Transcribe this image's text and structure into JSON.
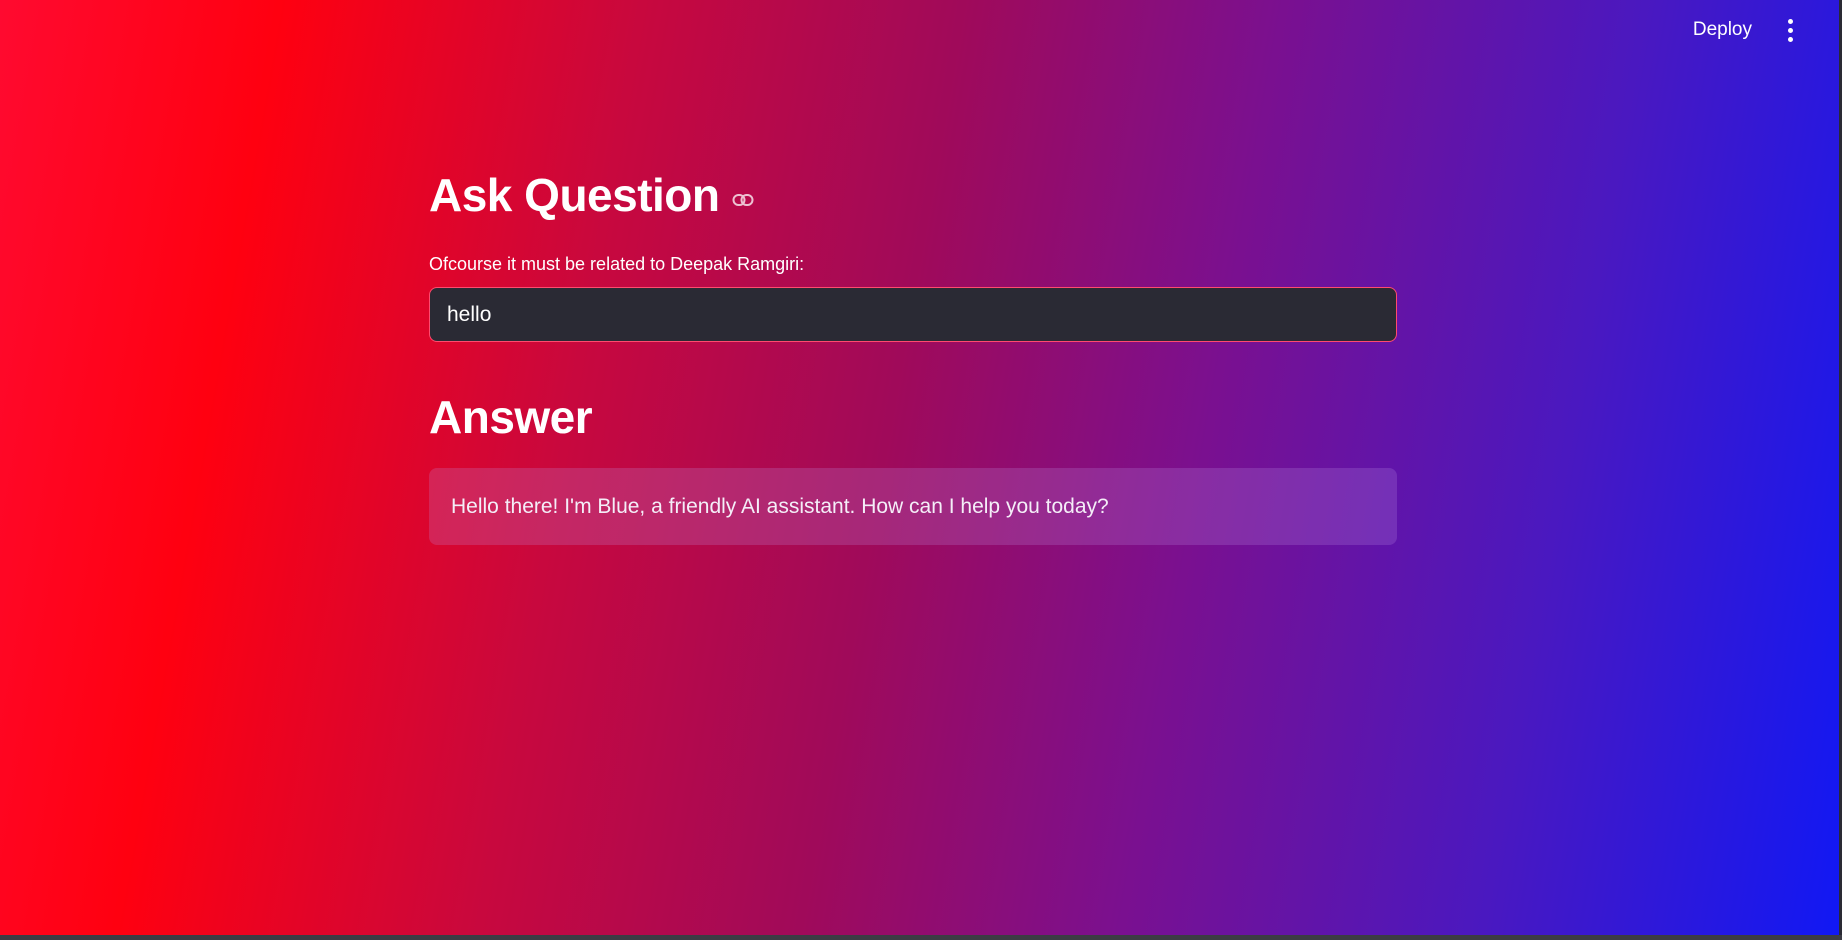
{
  "header": {
    "deploy_label": "Deploy",
    "menu_icon": "kebab-menu-icon"
  },
  "main": {
    "title": "Ask Question",
    "title_link_icon": "link-icon",
    "question_label": "Ofcourse it must be related to Deepak Ramgiri:",
    "question_value": "hello",
    "answer_heading": "Answer",
    "answer_text": "Hello there! I'm Blue, a friendly AI assistant. How can I help you today?"
  },
  "colors": {
    "gradient_start": "#ff0a30",
    "gradient_end": "#1018f5",
    "input_background": "#2a2a34",
    "input_border": "#ff4b6e"
  }
}
